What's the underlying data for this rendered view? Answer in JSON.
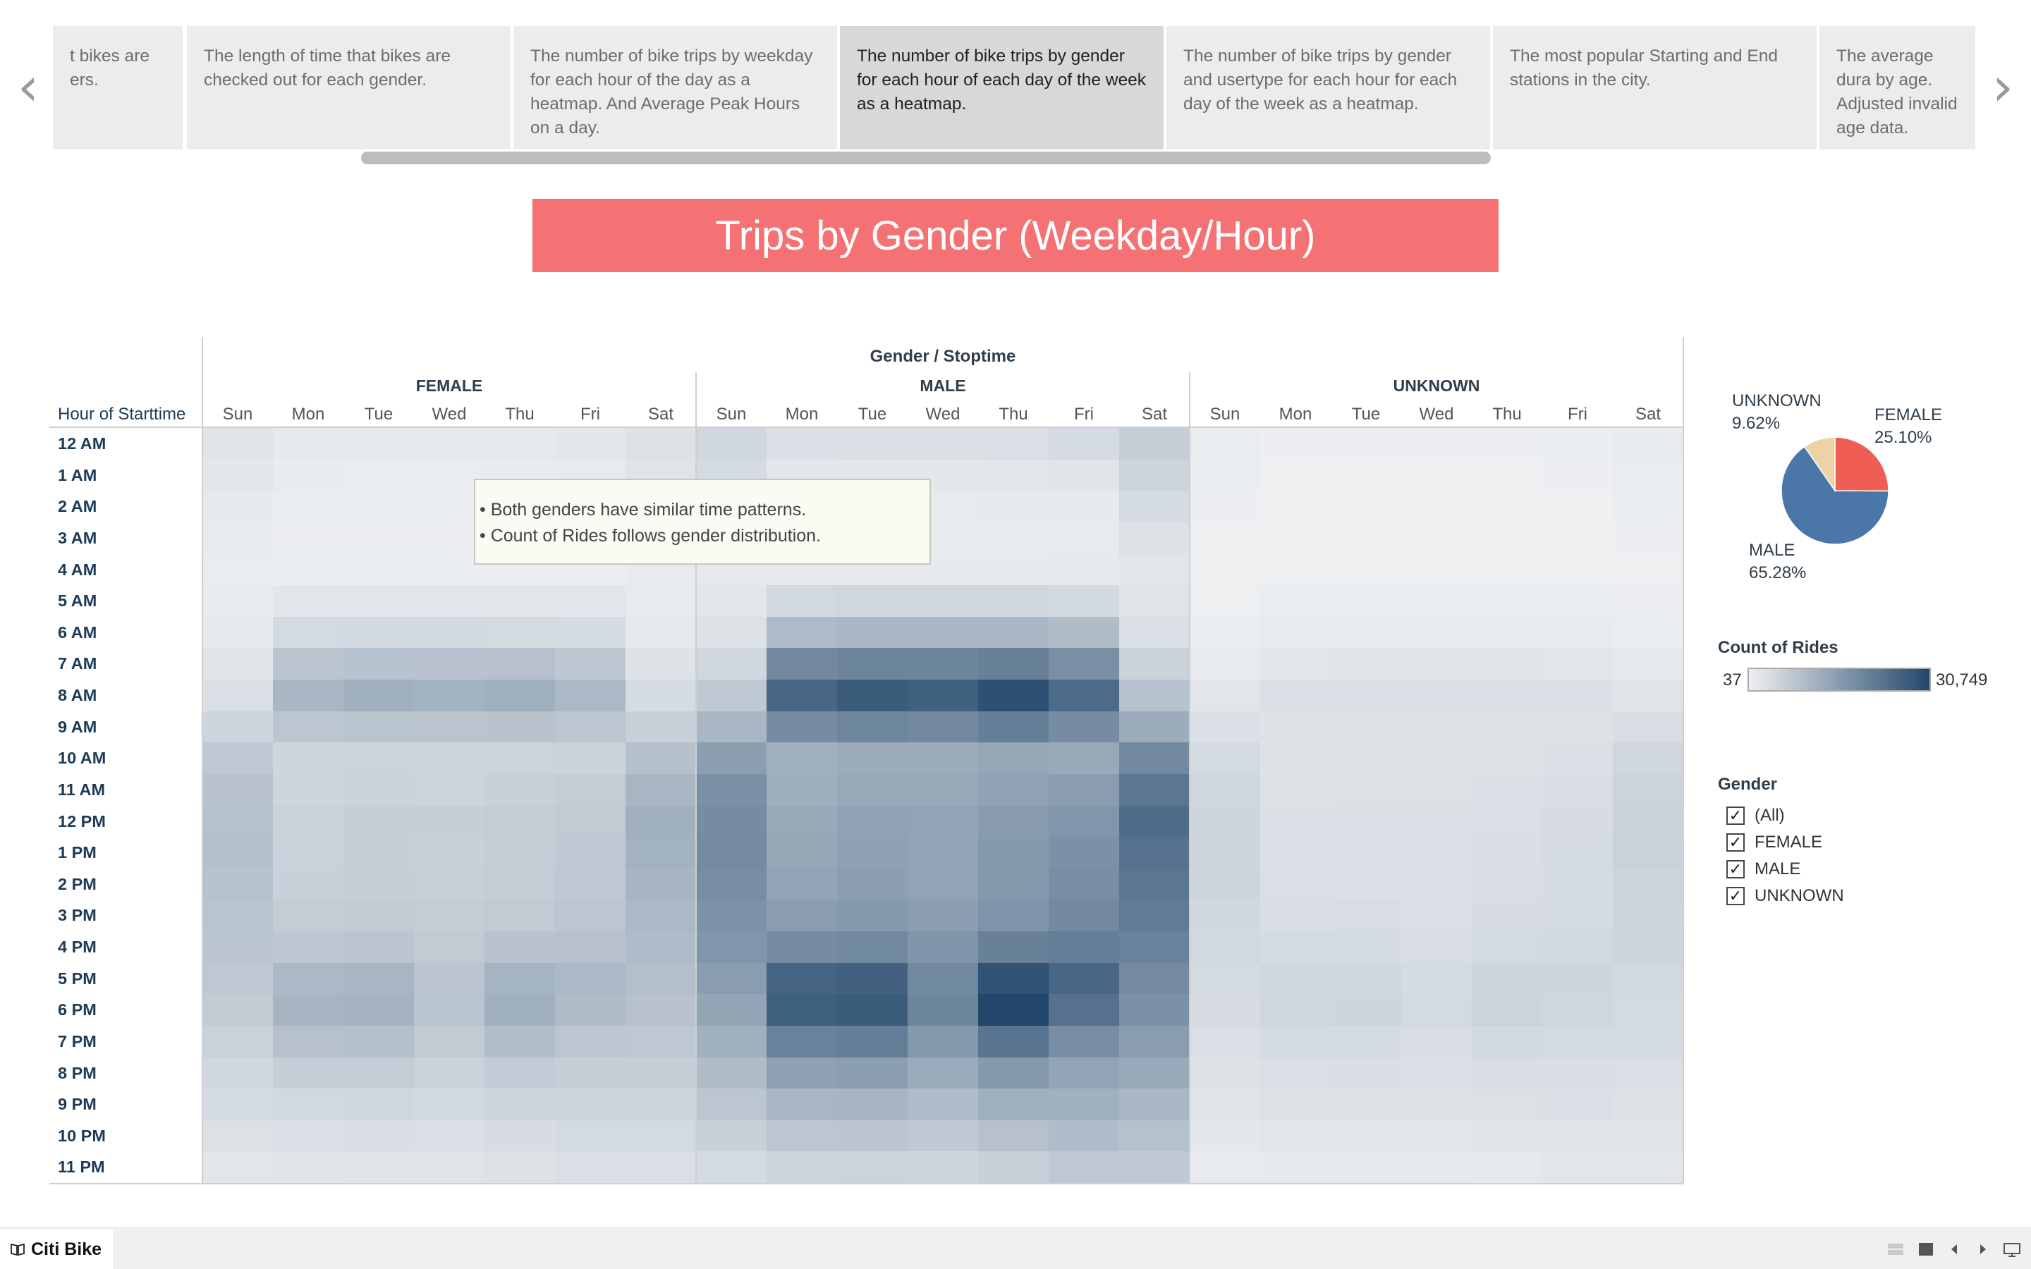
{
  "story": {
    "nav_prev_icon": "chevron-left-icon",
    "nav_next_icon": "chevron-right-icon",
    "points": [
      {
        "text": "t bikes are\ners."
      },
      {
        "text": "The length of time that bikes are checked out for each gender."
      },
      {
        "text": "The number of bike trips by weekday for each hour of the day as a heatmap. And Average Peak Hours on a day."
      },
      {
        "text": "The number of bike trips by gender for each hour of each day of the week as a heatmap.",
        "active": true
      },
      {
        "text": "The number of bike trips by gender and usertype for each hour for each day of the week as a heatmap."
      },
      {
        "text": "The most popular Starting and End stations in the city."
      },
      {
        "text": "The average dura by age. Adjusted invalid age data."
      }
    ]
  },
  "dashboard": {
    "title": "Trips by Gender (Weekday/Hour)"
  },
  "heatmap": {
    "column_header": "Gender / Stoptime",
    "row_header": "Hour of Starttime",
    "groups": [
      "FEMALE",
      "MALE",
      "UNKNOWN"
    ],
    "days": [
      "Sun",
      "Mon",
      "Tue",
      "Wed",
      "Thu",
      "Fri",
      "Sat"
    ],
    "hours": [
      "12 AM",
      "1 AM",
      "2 AM",
      "3 AM",
      "4 AM",
      "5 AM",
      "6 AM",
      "7 AM",
      "8 AM",
      "9 AM",
      "10 AM",
      "11 AM",
      "12 PM",
      "1 PM",
      "2 PM",
      "3 PM",
      "4 PM",
      "5 PM",
      "6 PM",
      "7 PM",
      "8 PM",
      "9 PM",
      "10 PM",
      "11 PM"
    ],
    "annotation": [
      "• Both genders have similar time patterns.",
      "• Count of Rides follows gender distribution."
    ]
  },
  "pie": {
    "title": "",
    "slices": [
      {
        "label": "FEMALE",
        "pct_text": "25.10%",
        "value": 25.1,
        "color": "#ef5d55"
      },
      {
        "label": "MALE",
        "pct_text": "65.28%",
        "value": 65.28,
        "color": "#4a76a8"
      },
      {
        "label": "UNKNOWN",
        "pct_text": "9.62%",
        "value": 9.62,
        "color": "#edd2a6"
      }
    ]
  },
  "legend": {
    "title": "Count of Rides",
    "min": "37",
    "max": "30,749",
    "color_low": "#eef0f2",
    "color_high": "#22476b"
  },
  "filter": {
    "title": "Gender",
    "items": [
      "(All)",
      "FEMALE",
      "MALE",
      "UNKNOWN"
    ],
    "checked": [
      true,
      true,
      true,
      true
    ],
    "check_glyph": "✓"
  },
  "bottom_bar": {
    "brand": "Citi Bike",
    "brand_icon": "book-icon"
  },
  "chart_data": {
    "type": "heatmap",
    "title": "Trips by Gender (Weekday/Hour)",
    "xlabel": "Gender / Stoptime",
    "ylabel": "Hour of Starttime",
    "x_groups": [
      "FEMALE",
      "MALE",
      "UNKNOWN"
    ],
    "x_categories": [
      "Sun",
      "Mon",
      "Tue",
      "Wed",
      "Thu",
      "Fri",
      "Sat"
    ],
    "y_categories": [
      "12 AM",
      "1 AM",
      "2 AM",
      "3 AM",
      "4 AM",
      "5 AM",
      "6 AM",
      "7 AM",
      "8 AM",
      "9 AM",
      "10 AM",
      "11 AM",
      "12 PM",
      "1 PM",
      "2 PM",
      "3 PM",
      "4 PM",
      "5 PM",
      "6 PM",
      "7 PM",
      "8 PM",
      "9 PM",
      "10 PM",
      "11 PM"
    ],
    "color_range": [
      37,
      30749
    ],
    "series": [
      {
        "name": "FEMALE",
        "values": [
          [
            1500,
            900,
            800,
            800,
            900,
            1100,
            1900
          ],
          [
            1200,
            500,
            400,
            400,
            500,
            600,
            1600
          ],
          [
            900,
            300,
            300,
            300,
            300,
            400,
            1300
          ],
          [
            600,
            200,
            200,
            200,
            200,
            300,
            900
          ],
          [
            400,
            300,
            300,
            300,
            300,
            300,
            600
          ],
          [
            500,
            1200,
            1300,
            1300,
            1300,
            1200,
            600
          ],
          [
            800,
            3200,
            3400,
            3400,
            3300,
            3000,
            900
          ],
          [
            1500,
            6800,
            7300,
            7200,
            7400,
            6400,
            1800
          ],
          [
            2500,
            9300,
            10400,
            10000,
            10700,
            9000,
            3000
          ],
          [
            4200,
            6500,
            7000,
            6900,
            7100,
            6600,
            4800
          ],
          [
            6000,
            3900,
            4300,
            4200,
            4400,
            4500,
            7700
          ],
          [
            7100,
            4000,
            4500,
            4400,
            4800,
            5300,
            9400
          ],
          [
            7500,
            4500,
            5000,
            5000,
            5300,
            5800,
            10500
          ],
          [
            7600,
            4600,
            5000,
            4800,
            5400,
            6000,
            10100
          ],
          [
            7300,
            4800,
            5200,
            4900,
            5400,
            6200,
            9600
          ],
          [
            7000,
            5300,
            5500,
            5200,
            5800,
            6600,
            9000
          ],
          [
            6800,
            6400,
            6700,
            5800,
            7200,
            7400,
            8500
          ],
          [
            6200,
            9000,
            9400,
            6800,
            9800,
            8900,
            7800
          ],
          [
            5600,
            9600,
            9900,
            7000,
            10500,
            8400,
            7200
          ],
          [
            4700,
            7400,
            7600,
            5800,
            8100,
            6600,
            6300
          ],
          [
            3700,
            5200,
            5400,
            4500,
            5700,
            5100,
            5200
          ],
          [
            3000,
            3600,
            3800,
            3400,
            4100,
            4200,
            4100
          ],
          [
            2100,
            2400,
            2600,
            2400,
            2900,
            3300,
            3200
          ],
          [
            1400,
            1500,
            1600,
            1600,
            1900,
            2400,
            2400
          ]
        ]
      },
      {
        "name": "MALE",
        "values": [
          [
            3700,
            2200,
            2300,
            2300,
            2500,
            3000,
            5000
          ],
          [
            3000,
            1200,
            1100,
            1100,
            1200,
            1500,
            4100
          ],
          [
            2100,
            700,
            700,
            700,
            800,
            900,
            3000
          ],
          [
            1300,
            500,
            500,
            500,
            500,
            600,
            2000
          ],
          [
            1000,
            800,
            800,
            800,
            800,
            800,
            1400
          ],
          [
            1400,
            3500,
            3800,
            3800,
            3700,
            3400,
            1700
          ],
          [
            2100,
            8700,
            9200,
            9300,
            9100,
            8200,
            2400
          ],
          [
            3800,
            17700,
            18600,
            18400,
            19300,
            16700,
            4500
          ],
          [
            6100,
            24400,
            26500,
            25800,
            28700,
            23700,
            7300
          ],
          [
            9300,
            17200,
            18100,
            17900,
            19600,
            17100,
            11200
          ],
          [
            13600,
            10500,
            11400,
            11200,
            12200,
            11800,
            17700
          ],
          [
            16400,
            10900,
            12000,
            11800,
            13000,
            13900,
            21400
          ],
          [
            17100,
            12000,
            13000,
            12900,
            14300,
            15300,
            23300
          ],
          [
            17400,
            12300,
            13300,
            12600,
            14500,
            16200,
            22400
          ],
          [
            16900,
            12600,
            13600,
            12900,
            14800,
            16800,
            21500
          ],
          [
            16100,
            13800,
            14500,
            13600,
            15700,
            17700,
            20400
          ],
          [
            15300,
            17100,
            17800,
            15400,
            19300,
            19900,
            19200
          ],
          [
            13900,
            24900,
            25500,
            17800,
            28200,
            24300,
            17600
          ],
          [
            12400,
            25700,
            26500,
            18300,
            30749,
            22300,
            16300
          ],
          [
            10400,
            19200,
            19800,
            14700,
            21700,
            16800,
            13900
          ],
          [
            8200,
            13400,
            13700,
            11300,
            14600,
            12700,
            11500
          ],
          [
            6600,
            9400,
            9600,
            8300,
            10400,
            10400,
            9200
          ],
          [
            4800,
            6500,
            6800,
            6100,
            7400,
            8300,
            7500
          ],
          [
            3200,
            4100,
            4300,
            4100,
            4800,
            6200,
            6100
          ]
        ]
      },
      {
        "name": "UNKNOWN",
        "values": [
          [
            400,
            200,
            200,
            200,
            200,
            300,
            500
          ],
          [
            300,
            100,
            100,
            100,
            100,
            200,
            400
          ],
          [
            200,
            100,
            100,
            100,
            100,
            100,
            300
          ],
          [
            100,
            37,
            37,
            37,
            37,
            100,
            200
          ],
          [
            100,
            100,
            100,
            100,
            100,
            100,
            100
          ],
          [
            150,
            300,
            300,
            300,
            300,
            300,
            200
          ],
          [
            300,
            700,
            700,
            700,
            700,
            700,
            400
          ],
          [
            700,
            1400,
            1500,
            1500,
            1500,
            1400,
            900
          ],
          [
            1300,
            2200,
            2300,
            2300,
            2400,
            2200,
            1600
          ],
          [
            2300,
            1900,
            2000,
            2000,
            2100,
            2000,
            2600
          ],
          [
            3300,
            1800,
            1900,
            1900,
            2000,
            2200,
            3800
          ],
          [
            3800,
            2000,
            2100,
            2100,
            2300,
            2600,
            4400
          ],
          [
            4000,
            2200,
            2300,
            2300,
            2500,
            2900,
            4700
          ],
          [
            4000,
            2300,
            2400,
            2300,
            2600,
            3000,
            4600
          ],
          [
            3900,
            2400,
            2500,
            2400,
            2700,
            3100,
            4400
          ],
          [
            3700,
            2600,
            2700,
            2500,
            2900,
            3300,
            4200
          ],
          [
            3500,
            3000,
            3100,
            2800,
            3300,
            3600,
            3900
          ],
          [
            3200,
            3700,
            3800,
            3100,
            4100,
            4000,
            3600
          ],
          [
            2900,
            3800,
            3900,
            3200,
            4300,
            3800,
            3300
          ],
          [
            2500,
            3200,
            3300,
            2800,
            3500,
            3200,
            3000
          ],
          [
            2000,
            2500,
            2600,
            2300,
            2700,
            2600,
            2500
          ],
          [
            1600,
            1900,
            2000,
            1800,
            2100,
            2200,
            2000
          ],
          [
            1100,
            1300,
            1400,
            1300,
            1500,
            1700,
            1700
          ],
          [
            700,
            900,
            900,
            900,
            1000,
            1300,
            1300
          ]
        ]
      }
    ]
  }
}
